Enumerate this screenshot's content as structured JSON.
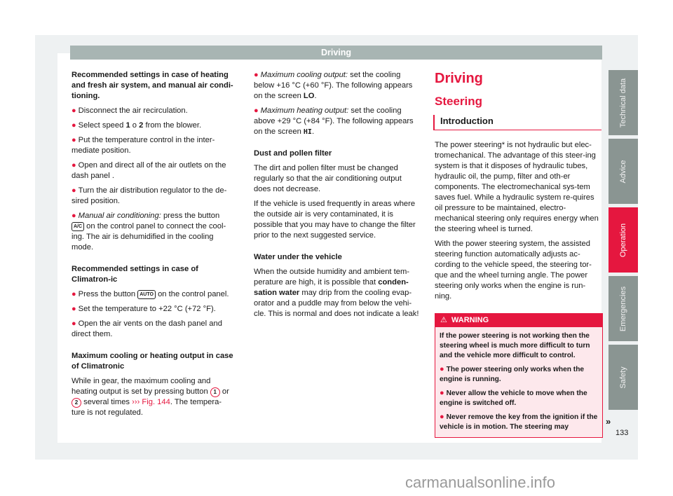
{
  "header": {
    "title": "Driving"
  },
  "column1": {
    "heading1": "Recommended settings in case of heating and fresh air system, and manual air condi-tioning.",
    "bullets1": [
      "Disconnect the air recirculation.",
      "from the blower.",
      "Put the temperature control in the inter-mediate position.",
      "Open and direct all of the air outlets on the dash panel .",
      "Turn the air distribution regulator to the de-sired position."
    ],
    "select_speed_prefix": "Select speed",
    "speed_1": "1",
    "speed_or": "o",
    "speed_2": "2",
    "manual_ac_label": "Manual air conditioning:",
    "manual_ac_pre": "press the button",
    "ac_key": "A/C",
    "manual_ac_post": "on the control panel to connect the cool-ing. The air is dehumidified in the cooling mode.",
    "heading2": "Recommended settings in case of Climatron-ic",
    "press_pre": "Press the button",
    "auto_key": "AUTO",
    "press_post": "on the control panel.",
    "bullets2": [
      "Set the temperature to +22 °C (+72 °F).",
      "Open the air vents on the dash panel and direct them."
    ],
    "heading3": "Maximum cooling or heating output in case of Climatronic",
    "max_text_pre": "While in gear, the maximum cooling and heating output is set by pressing button",
    "button_1": "1",
    "or": "or",
    "button_2": "2",
    "max_text_mid": "several times",
    "fig_ref": "››› Fig. 144",
    "max_text_post": ". The tempera-ture is not regulated."
  },
  "column2": {
    "cool_label": "Maximum cooling output:",
    "cool_text": "set the cooling below +16 °C (+60 °F). The following appears on the screen",
    "cool_screen": "LO",
    "heat_label": "Maximum heating output:",
    "heat_text": "set the cooling above +29 °C (+84 °F). The following appears on the screen",
    "heat_screen": "HI",
    "dust_heading": "Dust and pollen filter",
    "dust_p1": "The dirt and pollen filter must be changed regularly so that the air conditioning output does not decrease.",
    "dust_p2": "If the vehicle is used frequently in areas where the outside air is very contaminated, it is possible that you may have to change the filter prior to the next suggested service.",
    "water_heading": "Water under the vehicle",
    "water_pre": "When the outside humidity and ambient tem-perature are high, it is possible that",
    "water_bold": "conden-sation water",
    "water_post": "may drip from the cooling evap-orator and a puddle may from below the vehi-cle. This is normal and does not indicate a leak!"
  },
  "column3": {
    "title": "Driving",
    "subtitle": "Steering",
    "section": "Introduction",
    "p1": "The power steering* is not hydraulic but elec-tromechanical. The advantage of this steer-ing system is that it disposes of hydraulic tubes, hydraulic oil, the pump, filter and oth-er components. The electromechanical sys-tem saves fuel. While a hydraulic system re-quires oil pressure to be maintained, electro-mechanical steering only requires energy when the steering wheel is turned.",
    "p2": "With the power steering system, the assisted steering function automatically adjusts ac-cording to the vehicle speed, the steering tor-que and the wheel turning angle. The power steering only works when the engine is run-ning.",
    "warning": {
      "icon": "warning-triangle-icon",
      "label": "WARNING",
      "intro": "If the power steering is not working then the steering wheel is much more difficult to turn and the vehicle more difficult to control.",
      "bullets": [
        "The power steering only works when the engine is running.",
        "Never allow the vehicle to move when the engine is switched off.",
        "Never remove the key from the ignition if the vehicle is in motion. The steering may"
      ]
    },
    "continued": "»"
  },
  "side_tabs": [
    {
      "label": "Technical data",
      "active": false
    },
    {
      "label": "Advice",
      "active": false
    },
    {
      "label": "Operation",
      "active": true
    },
    {
      "label": "Emergencies",
      "active": false
    },
    {
      "label": "Safety",
      "active": false
    }
  ],
  "page_number": "133",
  "watermark": "carmanualsonline.info",
  "colors": {
    "accent": "#e5173f",
    "tab_gray": "#8a9592",
    "header_gray": "#a8b5b3"
  }
}
